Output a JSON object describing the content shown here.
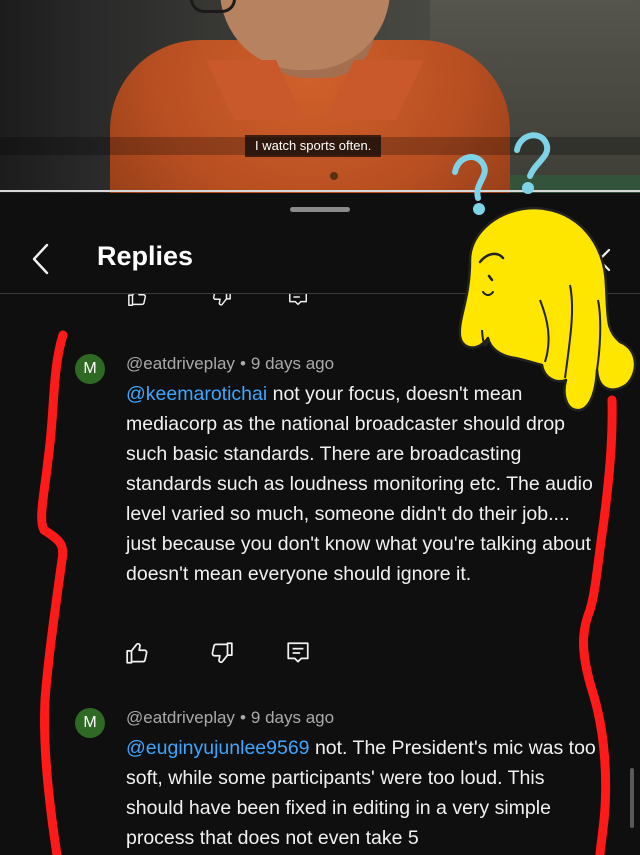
{
  "video": {
    "caption": "I watch sports often."
  },
  "header": {
    "title": "Replies"
  },
  "comments": [
    {
      "avatar_letter": "M",
      "author": "@eatdriveplay",
      "time": "9 days ago",
      "mention": "@keemarotichai",
      "text": " not your focus, doesn't mean mediacorp as the national broadcaster should drop such basic standards. There are broadcasting standards such as loudness monitoring etc. The audio level varied so much, someone didn't do their job.... just because you don't know what you're talking about doesn't mean everyone should ignore it."
    },
    {
      "avatar_letter": "M",
      "author": "@eatdriveplay",
      "time": "9 days ago",
      "mention": "@euginyujunlee9569",
      "text": " not. The President's mic was too soft, while some participants' were too loud. This should have been fixed in editing in a very simple process that does not even take 5"
    }
  ],
  "icons": {
    "back": "chevron-left-icon",
    "close": "close-icon",
    "like": "thumbs-up-icon",
    "dislike": "thumbs-down-icon",
    "reply": "reply-icon",
    "sticker": "confused-yellow-blob-sticker"
  },
  "colors": {
    "background": "#0f0f0f",
    "mention": "#3ea6ff",
    "avatar": "#2f6a24",
    "marker": "#ff1a1a",
    "sticker": "#ffe600",
    "question_marks": "#7fd3e6"
  }
}
